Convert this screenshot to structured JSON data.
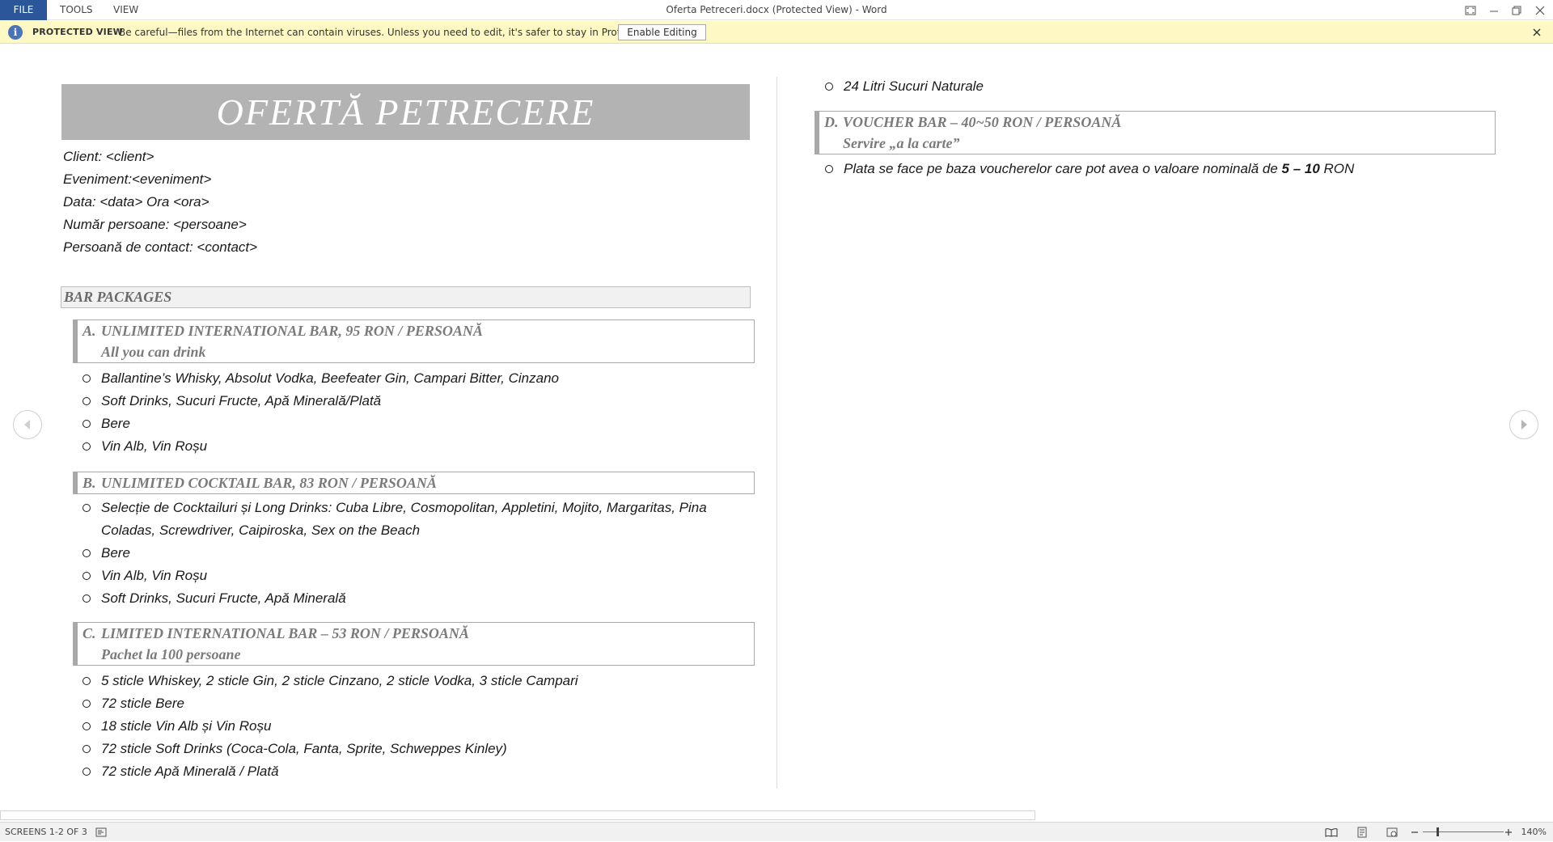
{
  "titlebar": {
    "menus": [
      "FILE",
      "TOOLS",
      "VIEW"
    ],
    "window_title": "Oferta Petreceri.docx (Protected View) - Word"
  },
  "protected_view": {
    "title": "PROTECTED VIEW",
    "message": "Be careful—files from the Internet can contain viruses. Unless you need to edit, it's safer to stay in Protected View.",
    "button": "Enable Editing"
  },
  "document": {
    "title": "OFERTĂ PETRECERE",
    "info": [
      "Client: <client>",
      "Eveniment:<eveniment>",
      "Data: <data> Ora <ora>",
      "Număr persoane: <persoane>",
      "Persoană de contact: <contact>"
    ],
    "bar_packages_heading": "BAR PACKAGES",
    "sections": [
      {
        "letter": "A.",
        "line1": "UNLIMITED INTERNATIONAL BAR, 95 RON / PERSOANĂ",
        "line2": "All you can drink",
        "items": [
          "Ballantine’s Whisky, Absolut Vodka, Beefeater Gin, Campari Bitter, Cinzano",
          "Soft Drinks, Sucuri Fructe, Apă Minerală/Plată",
          "Bere",
          "Vin Alb, Vin Roșu"
        ]
      },
      {
        "letter": "B.",
        "line1": "UNLIMITED COCKTAIL BAR, 83 RON / PERSOANĂ",
        "line2": "",
        "items": [
          "Selecție de Cocktailuri și Long Drinks: Cuba Libre, Cosmopolitan, Appletini, Mojito, Margaritas, Pina",
          "Coladas, Screwdriver, Caipiroska, Sex on the Beach",
          "Bere",
          "Vin Alb, Vin Roșu",
          "Soft Drinks, Sucuri Fructe, Apă Minerală"
        ]
      },
      {
        "letter": "C.",
        "line1": "LIMITED INTERNATIONAL BAR – 53 RON / PERSOANĂ",
        "line2": "Pachet la 100 persoane",
        "items": [
          "5 sticle Whiskey, 2 sticle Gin, 2 sticle Cinzano, 2 sticle Vodka, 3 sticle Campari",
          "72 sticle Bere",
          "18 sticle Vin Alb și Vin Roșu",
          "72 sticle Soft Drinks (Coca-Cola, Fanta, Sprite, Schweppes Kinley)",
          "72 sticle Apă Minerală / Plată",
          "24 Litri Sucuri Naturale"
        ]
      },
      {
        "letter": "D.",
        "line1": "VOUCHER BAR – 40~50 RON / PERSOANĂ",
        "line2": "Servire „a la carte”",
        "item_before": "Plata se face pe baza voucherelor care pot avea o valoare nominală de ",
        "item_bold": "5 – 10",
        "item_after": " RON"
      }
    ]
  },
  "status": {
    "screens": "SCREENS 1-2 OF 3",
    "zoom": "140%"
  }
}
